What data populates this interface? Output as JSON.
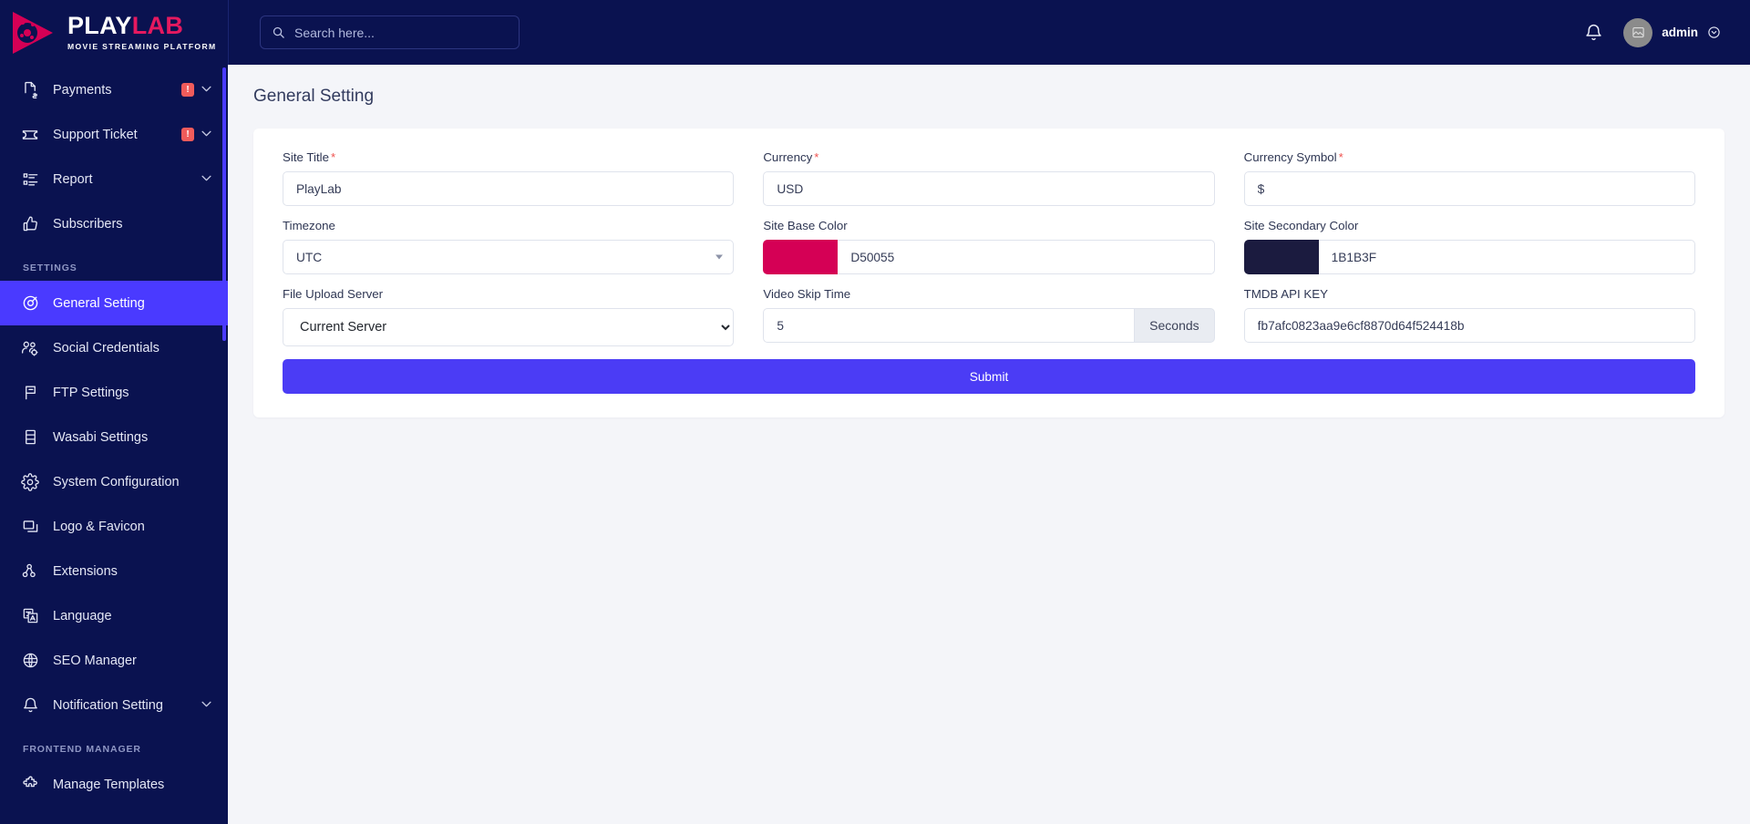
{
  "brand": {
    "name_part1": "PLAY",
    "name_part2": "LAB",
    "tagline": "MOVIE STREAMING PLATFORM",
    "accent_pink": "#d50055",
    "sidebar_bg": "#0a1250",
    "active_bg": "#4a3aff"
  },
  "topbar": {
    "search_placeholder": "Search here...",
    "user_name": "admin"
  },
  "sidebar": {
    "items": [
      {
        "label": "Payments",
        "icon": "invoice-dollar-icon",
        "badge": "!",
        "caret": "⌄"
      },
      {
        "label": "Support Ticket",
        "icon": "ticket-icon",
        "badge": "!",
        "caret": "⌄"
      },
      {
        "label": "Report",
        "icon": "report-list-icon",
        "badge": "",
        "caret": "⌄"
      },
      {
        "label": "Subscribers",
        "icon": "thumbs-up-icon",
        "badge": "",
        "caret": ""
      }
    ],
    "section_settings": "SETTINGS",
    "settings_items": [
      {
        "label": "General Setting",
        "icon": "circle-target-icon",
        "active": true,
        "caret": ""
      },
      {
        "label": "Social Credentials",
        "icon": "users-gear-icon",
        "active": false,
        "caret": ""
      },
      {
        "label": "FTP Settings",
        "icon": "flag-icon",
        "active": false,
        "caret": ""
      },
      {
        "label": "Wasabi Settings",
        "icon": "server-icon",
        "active": false,
        "caret": ""
      },
      {
        "label": "System Configuration",
        "icon": "gear-icon",
        "active": false,
        "caret": ""
      },
      {
        "label": "Logo & Favicon",
        "icon": "windows-icon",
        "active": false,
        "caret": ""
      },
      {
        "label": "Extensions",
        "icon": "extensions-icon",
        "active": false,
        "caret": ""
      },
      {
        "label": "Language",
        "icon": "language-icon",
        "active": false,
        "caret": ""
      },
      {
        "label": "SEO Manager",
        "icon": "globe-icon",
        "active": false,
        "caret": ""
      },
      {
        "label": "Notification Setting",
        "icon": "bell-icon",
        "active": false,
        "caret": "⌄"
      }
    ],
    "section_frontend": "FRONTEND MANAGER",
    "frontend_items": [
      {
        "label": "Manage Templates",
        "icon": "puzzle-icon",
        "caret": ""
      }
    ]
  },
  "page": {
    "title": "General Setting"
  },
  "form": {
    "site_title": {
      "label": "Site Title",
      "required": true,
      "value": "PlayLab"
    },
    "currency": {
      "label": "Currency",
      "required": true,
      "value": "USD"
    },
    "currency_symbol": {
      "label": "Currency Symbol",
      "required": true,
      "value": "$"
    },
    "timezone": {
      "label": "Timezone",
      "required": false,
      "value": "UTC",
      "options": [
        "UTC"
      ]
    },
    "site_base_color": {
      "label": "Site Base Color",
      "required": false,
      "value": "D50055",
      "swatch": "#d50055"
    },
    "site_secondary_color": {
      "label": "Site Secondary Color",
      "required": false,
      "value": "1B1B3F",
      "swatch": "#1b1b3f"
    },
    "file_upload_server": {
      "label": "File Upload Server",
      "required": false,
      "value": "Current Server",
      "options": [
        "Current Server"
      ]
    },
    "video_skip_time": {
      "label": "Video Skip Time",
      "required": false,
      "value": "5",
      "addon": "Seconds"
    },
    "tmdb_api_key": {
      "label": "TMDB API KEY",
      "required": false,
      "value": "fb7afc0823aa9e6cf8870d64f524418b"
    },
    "submit_label": "Submit",
    "submit_color": "#4b3cf5"
  }
}
